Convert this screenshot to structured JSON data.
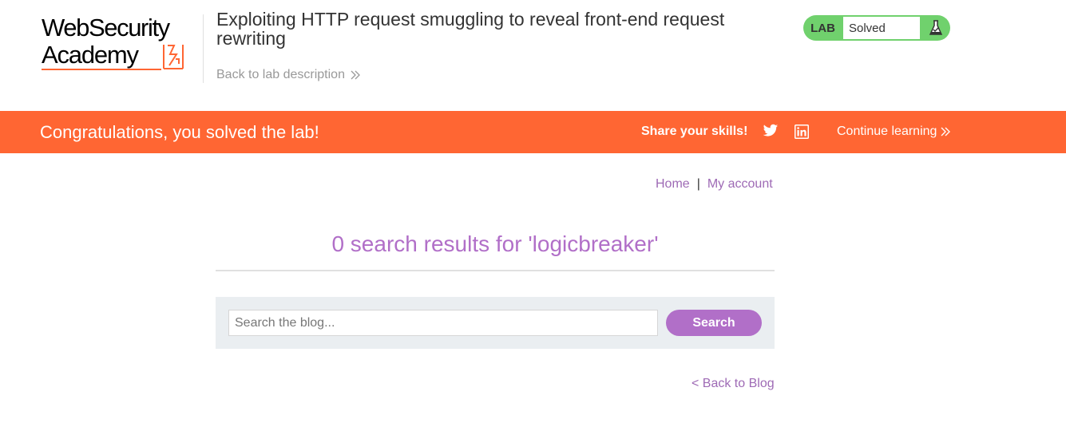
{
  "header": {
    "logo": {
      "line1": "WebSecurity",
      "line2": "Academy"
    },
    "lab_title": "Exploiting HTTP request smuggling to reveal front-end request rewriting",
    "back_to_description": "Back to lab description",
    "status": {
      "badge": "LAB",
      "value": "Solved",
      "icon": "flask-check-icon"
    }
  },
  "banner": {
    "message": "Congratulations, you solved the lab!",
    "share_label": "Share your skills!",
    "share_icons": [
      "twitter-icon",
      "linkedin-icon"
    ],
    "continue_label": "Continue learning"
  },
  "nav": {
    "home": "Home",
    "separator": "|",
    "account": "My account"
  },
  "main": {
    "results_heading": "0 search results for 'logicbreaker'",
    "search": {
      "placeholder": "Search the blog...",
      "value": "",
      "button": "Search"
    },
    "back_link": "< Back to Blog"
  },
  "colors": {
    "accent_orange": "#ff6633",
    "status_green": "#70d16d",
    "link_purple": "#9e6ab5",
    "button_purple": "#b16fc8"
  }
}
